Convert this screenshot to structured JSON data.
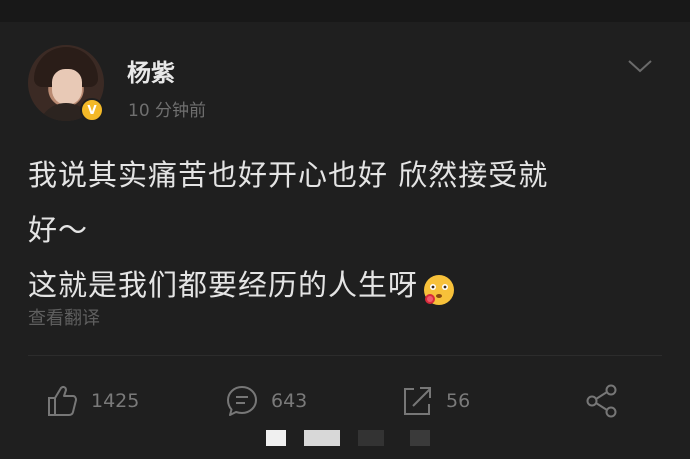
{
  "post": {
    "author": "杨紫",
    "verified_badge": "V",
    "time": "10 分钟前",
    "content_lines": [
      "我说其实痛苦也好开心也好 欣然接受就",
      "好～",
      "这就是我们都要经历的人生呀"
    ],
    "emoji": "blushing-face-icon",
    "translate_label": "查看翻译"
  },
  "actions": {
    "likes": "1425",
    "comments": "643",
    "reposts": "56"
  },
  "colors": {
    "background": "#1f1f1f",
    "verified": "#f3b928",
    "muted_text": "#6f6f6f"
  }
}
